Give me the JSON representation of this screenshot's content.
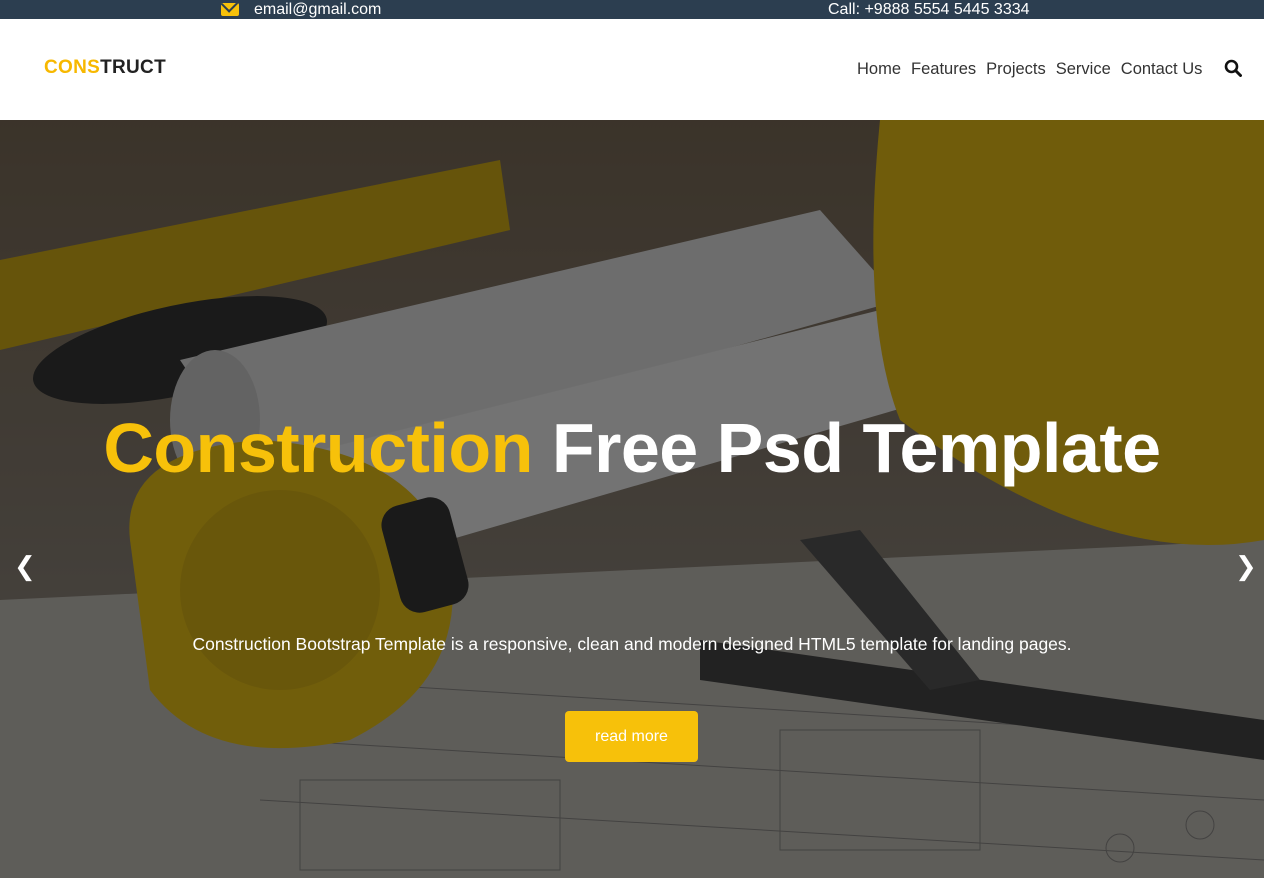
{
  "topbar": {
    "email": "email@gmail.com",
    "phone": "Call: +9888 5554 5445 3334",
    "email_icon": "envelope-icon"
  },
  "logo": {
    "part1": "CONS",
    "part2": "TRUCT"
  },
  "nav": {
    "items": [
      {
        "label": "Home"
      },
      {
        "label": "Features"
      },
      {
        "label": "Projects"
      },
      {
        "label": "Service"
      },
      {
        "label": "Contact Us"
      }
    ],
    "search_icon": "search-icon"
  },
  "hero": {
    "title_highlight": "Construction",
    "title_rest": "Free Psd Template",
    "subtitle": "Construction Bootstrap Template is a responsive, clean and modern designed HTML5 template for landing pages.",
    "button_label": "read more",
    "prev_arrow": "❮",
    "next_arrow": "❯"
  },
  "colors": {
    "accent": "#f7c10a",
    "topbar_bg": "#2c3e50",
    "text_dark": "#333333"
  }
}
